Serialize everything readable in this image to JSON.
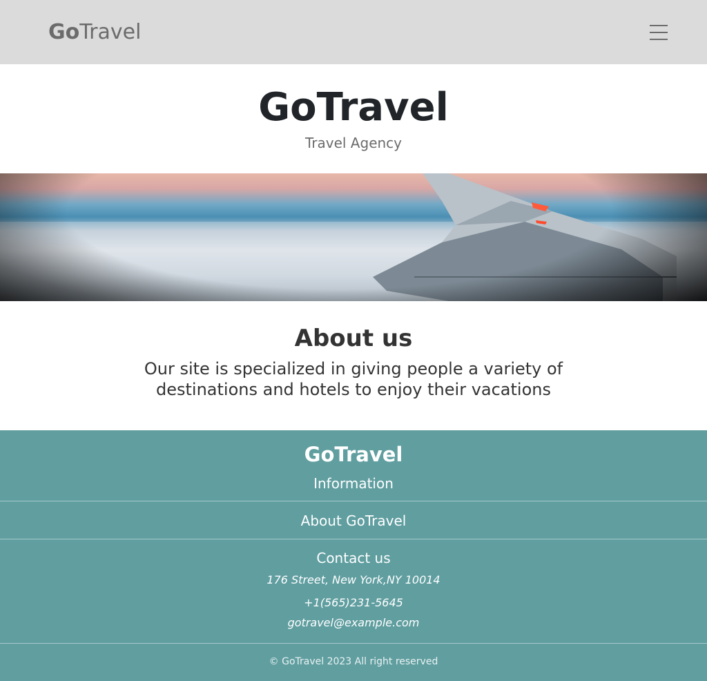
{
  "navbar": {
    "brand_bold": "Go",
    "brand_light": "Travel",
    "menu_icon": "hamburger-menu-icon"
  },
  "hero": {
    "title": "GoTravel",
    "subtitle": "Travel Agency"
  },
  "banner": {
    "image": "airplane-window-wing-view"
  },
  "about": {
    "title": "About us",
    "text": "Our site is specialized in giving people a variety of destinations and hotels to enjoy their vacations"
  },
  "footer": {
    "brand": "GoTravel",
    "information_heading": "Information",
    "about_link": "About GoTravel",
    "contact_heading": "Contact us",
    "address": "176 Street, New York,NY 10014",
    "phone": "+1(565)231-5645",
    "email": "gotravel@example.com",
    "copyright": "© GoTravel 2023   All right reserved"
  },
  "colors": {
    "navbar_bg": "#dbdbdb",
    "footer_bg": "#609ea0",
    "brand_text": "#6b6b6b"
  }
}
